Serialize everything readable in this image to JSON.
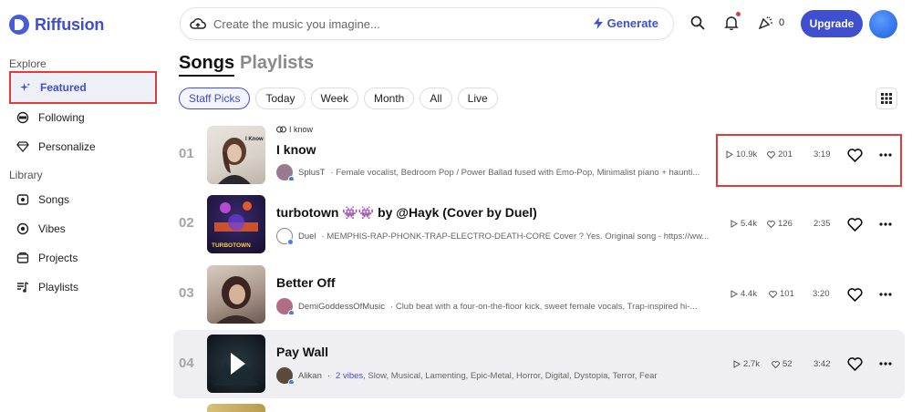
{
  "app": {
    "name": "Riffusion"
  },
  "sidebar": {
    "explore_label": "Explore",
    "library_label": "Library",
    "explore_items": [
      {
        "label": "Featured",
        "icon": "sparkle-icon",
        "active": true
      },
      {
        "label": "Following",
        "icon": "following-icon"
      },
      {
        "label": "Personalize",
        "icon": "gem-icon"
      }
    ],
    "library_items": [
      {
        "label": "Songs",
        "icon": "songs-icon"
      },
      {
        "label": "Vibes",
        "icon": "vibes-icon"
      },
      {
        "label": "Projects",
        "icon": "projects-icon"
      },
      {
        "label": "Playlists",
        "icon": "playlists-icon"
      }
    ]
  },
  "topbar": {
    "search_placeholder": "Create the music you imagine...",
    "generate_label": "Generate",
    "credits": "0",
    "upgrade_label": "Upgrade"
  },
  "tabs": {
    "songs": "Songs",
    "playlists": "Playlists"
  },
  "filters": [
    "Staff Picks",
    "Today",
    "Week",
    "Month",
    "All",
    "Live"
  ],
  "active_filter": "Staff Picks",
  "songs": [
    {
      "rank": "01",
      "remix_of": "I know",
      "title": "I know",
      "author": "SplusT",
      "description": "· Female vocalist, Bedroom Pop / Power Ballad fused with Emo-Pop, Minimalist piano + haunti...",
      "plays": "10.9k",
      "likes": "201",
      "duration": "3:19",
      "cover_text": "I Know"
    },
    {
      "rank": "02",
      "title": "turbotown 👾👾 by @Hayk (Cover by Duel)",
      "author": "Duel",
      "description": "· MEMPHIS-RAP-PHONK-TRAP-ELECTRO-DEATH-CORE Cover ? Yes. Original song - https://ww...",
      "plays": "5.4k",
      "likes": "126",
      "duration": "2:35",
      "cover_text": "TURBOTOWN"
    },
    {
      "rank": "03",
      "title": "Better Off",
      "author": "DemiGoddessOfMusic",
      "description": "· Club beat with a four-on-the-floor kick, sweet female vocals, Trap-inspired hi-...",
      "plays": "4.4k",
      "likes": "101",
      "duration": "3:20"
    },
    {
      "rank": "04",
      "title": "Pay Wall",
      "author": "Alikan",
      "vibes": "2 vibes",
      "description": ", Slow, Musical, Lamenting, Epic-Metal, Horror, Digital, Dystopia, Terror, Fear",
      "plays": "2.7k",
      "likes": "52",
      "duration": "3:42"
    }
  ],
  "colors": {
    "accent": "#3f4fd0",
    "highlight": "#e23b3b"
  }
}
